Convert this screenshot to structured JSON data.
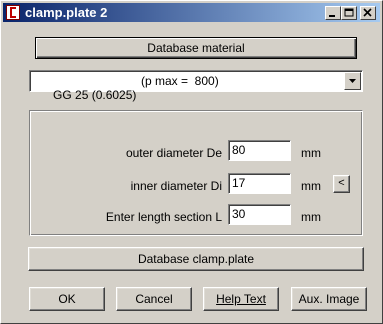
{
  "window": {
    "title": "clamp.plate 2"
  },
  "buttons": {
    "database_material": "Database material",
    "database_clamp_plate": "Database clamp.plate",
    "ok": "OK",
    "cancel": "Cancel",
    "help_text": "Help Text",
    "aux_image": "Aux. Image",
    "small_left": "<"
  },
  "material_select": {
    "selected_material": "GG 25 (0.6025)",
    "selected_pmax": "(p max =  800)"
  },
  "fields": {
    "outer_diameter": {
      "label": "outer diameter De",
      "value": "80",
      "unit": "mm"
    },
    "inner_diameter": {
      "label": "inner diameter Di",
      "value": "17",
      "unit": "mm"
    },
    "length_section": {
      "label": "Enter length section L",
      "value": "30",
      "unit": "mm"
    }
  },
  "icons": [
    "app-icon",
    "minimize-icon",
    "maximize-icon",
    "close-icon",
    "dropdown-arrow-icon"
  ]
}
